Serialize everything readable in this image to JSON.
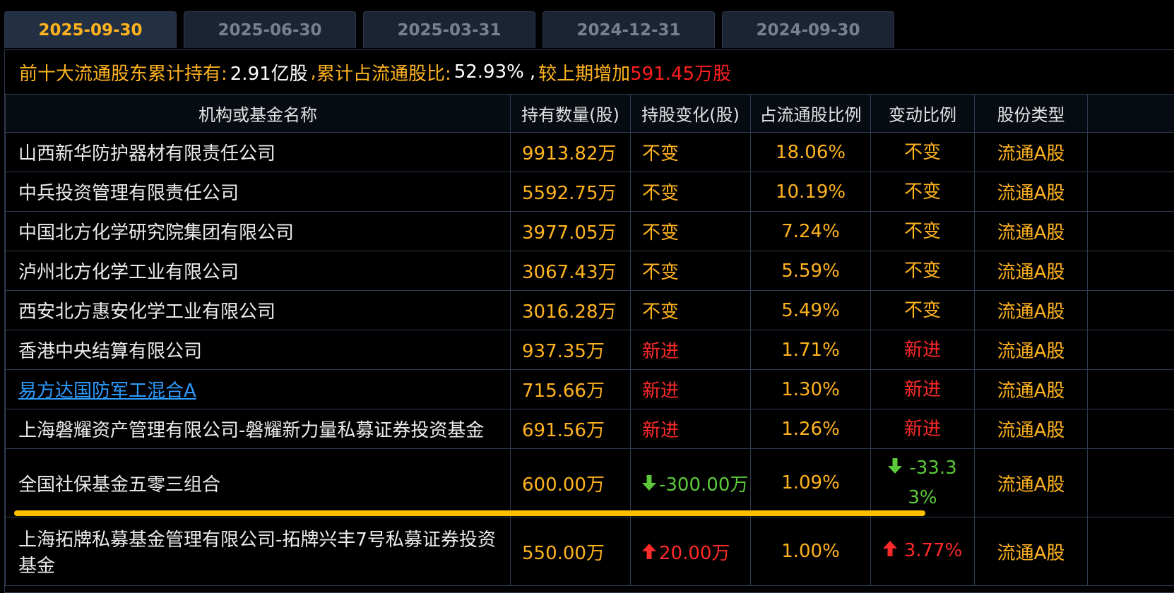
{
  "tabs": [
    {
      "label": "2025-09-30",
      "active": true
    },
    {
      "label": "2025-06-30",
      "active": false
    },
    {
      "label": "2025-03-31",
      "active": false
    },
    {
      "label": "2024-12-31",
      "active": false
    },
    {
      "label": "2024-09-30",
      "active": false
    }
  ],
  "summary": {
    "prefix": "前十大流通股东累计持有:",
    "total_holding": "2.91亿股",
    "sep1": ",",
    "ratio_label": "累计占流通股比:",
    "ratio_value": "52.93%",
    "sep2": ",",
    "change_label": "较上期增加",
    "change_value": "591.45万股"
  },
  "table": {
    "headers": [
      "机构或基金名称",
      "持有数量(股)",
      "持股变化(股)",
      "占流通股比例",
      "变动比例",
      "股份类型",
      ""
    ],
    "rows": [
      {
        "name": "山西新华防护器材有限责任公司",
        "link": false,
        "qty": "9913.82万",
        "change": "不变",
        "change_dir": "same",
        "pct": "18.06%",
        "ratio": "不变",
        "type": "流通A股"
      },
      {
        "name": "中兵投资管理有限责任公司",
        "link": false,
        "qty": "5592.75万",
        "change": "不变",
        "change_dir": "same",
        "pct": "10.19%",
        "ratio": "不变",
        "type": "流通A股"
      },
      {
        "name": "中国北方化学研究院集团有限公司",
        "link": false,
        "qty": "3977.05万",
        "change": "不变",
        "change_dir": "same",
        "pct": "7.24%",
        "ratio": "不变",
        "type": "流通A股"
      },
      {
        "name": "泸州北方化学工业有限公司",
        "link": false,
        "qty": "3067.43万",
        "change": "不变",
        "change_dir": "same",
        "pct": "5.59%",
        "ratio": "不变",
        "type": "流通A股"
      },
      {
        "name": "西安北方惠安化学工业有限公司",
        "link": false,
        "qty": "3016.28万",
        "change": "不变",
        "change_dir": "same",
        "pct": "5.49%",
        "ratio": "不变",
        "type": "流通A股"
      },
      {
        "name": "香港中央结算有限公司",
        "link": false,
        "qty": "937.35万",
        "change": "新进",
        "change_dir": "new",
        "pct": "1.71%",
        "ratio": "新进",
        "type": "流通A股"
      },
      {
        "name": "易方达国防军工混合A",
        "link": true,
        "qty": "715.66万",
        "change": "新进",
        "change_dir": "new",
        "pct": "1.30%",
        "ratio": "新进",
        "type": "流通A股"
      },
      {
        "name": "上海磐耀资产管理有限公司-磐耀新力量私募证券投资基金",
        "link": false,
        "qty": "691.56万",
        "change": "新进",
        "change_dir": "new",
        "pct": "1.26%",
        "ratio": "新进",
        "type": "流通A股"
      },
      {
        "name": "全国社保基金五零三组合",
        "link": false,
        "qty": "600.00万",
        "change": "-300.00万",
        "change_dir": "down",
        "pct": "1.09%",
        "ratio": "-33.33%",
        "type": "流通A股"
      },
      {
        "name": "上海拓牌私募基金管理有限公司-拓牌兴丰7号私募证券投资基金",
        "link": false,
        "qty": "550.00万",
        "change": "20.00万",
        "change_dir": "up",
        "pct": "1.00%",
        "ratio": "3.77%",
        "type": "流通A股"
      }
    ]
  },
  "icons": {
    "up": "arrow-up-icon",
    "down": "arrow-down-icon"
  },
  "colors": {
    "accent": "#ffb31f",
    "up": "#ff2a2a",
    "down": "#5cc93a",
    "link": "#2d9cff"
  }
}
